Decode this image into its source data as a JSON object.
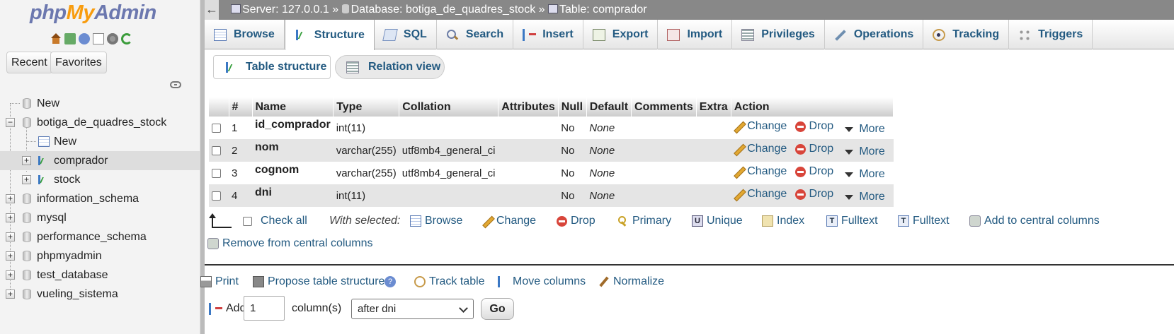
{
  "sidebar": {
    "logo": {
      "php": "php",
      "my": "My",
      "admin": "Admin"
    },
    "icons": [
      "home-icon",
      "exit-icon",
      "help-icon",
      "docs-icon",
      "settings-icon",
      "reload-icon"
    ],
    "recent_label": "Recent",
    "favorites_label": "Favorites",
    "tree": [
      {
        "label": "New"
      },
      {
        "label": "botiga_de_quadres_stock"
      },
      {
        "label": "New"
      },
      {
        "label": "comprador"
      },
      {
        "label": "stock"
      },
      {
        "label": "information_schema"
      },
      {
        "label": "mysql"
      },
      {
        "label": "performance_schema"
      },
      {
        "label": "phpmyadmin"
      },
      {
        "label": "test_database"
      },
      {
        "label": "vueling_sistema"
      }
    ]
  },
  "breadcrumb": {
    "back": "←",
    "server": "Server: 127.0.0.1",
    "sep": "»",
    "database": "Database: botiga_de_quadres_stock",
    "table": "Table: comprador"
  },
  "topmenu": [
    {
      "label": "Browse"
    },
    {
      "label": "Structure"
    },
    {
      "label": "SQL"
    },
    {
      "label": "Search"
    },
    {
      "label": "Insert"
    },
    {
      "label": "Export"
    },
    {
      "label": "Import"
    },
    {
      "label": "Privileges"
    },
    {
      "label": "Operations"
    },
    {
      "label": "Tracking"
    },
    {
      "label": "Triggers"
    }
  ],
  "subtabs": {
    "table_structure": "Table structure",
    "relation_view": "Relation view"
  },
  "table": {
    "headers": [
      "#",
      "Name",
      "Type",
      "Collation",
      "Attributes",
      "Null",
      "Default",
      "Comments",
      "Extra",
      "Action"
    ],
    "rows": [
      {
        "num": "1",
        "name": "id_comprador",
        "type": "int(11)",
        "collation": "",
        "attributes": "",
        "null": "No",
        "default": "None",
        "comments": "",
        "extra": ""
      },
      {
        "num": "2",
        "name": "nom",
        "type": "varchar(255)",
        "collation": "utf8mb4_general_ci",
        "attributes": "",
        "null": "No",
        "default": "None",
        "comments": "",
        "extra": ""
      },
      {
        "num": "3",
        "name": "cognom",
        "type": "varchar(255)",
        "collation": "utf8mb4_general_ci",
        "attributes": "",
        "null": "No",
        "default": "None",
        "comments": "",
        "extra": ""
      },
      {
        "num": "4",
        "name": "dni",
        "type": "int(11)",
        "collation": "",
        "attributes": "",
        "null": "No",
        "default": "None",
        "comments": "",
        "extra": ""
      }
    ],
    "actions": {
      "change": "Change",
      "drop": "Drop",
      "more": "More"
    }
  },
  "bulk": {
    "check_all": "Check all",
    "with_selected": "With selected:",
    "browse": "Browse",
    "change": "Change",
    "drop": "Drop",
    "primary": "Primary",
    "unique": "Unique",
    "index": "Index",
    "fulltext1": "Fulltext",
    "fulltext2": "Fulltext",
    "add_central": "Add to central columns",
    "remove_central": "Remove from central columns"
  },
  "bottom": {
    "print": "Print",
    "propose": "Propose table structure",
    "help": "?",
    "track": "Track table",
    "move": "Move columns",
    "normalize": "Normalize",
    "add_label": "Add",
    "add_count": "1",
    "columns_label": "column(s)",
    "position_value": "after dni",
    "go": "Go"
  }
}
